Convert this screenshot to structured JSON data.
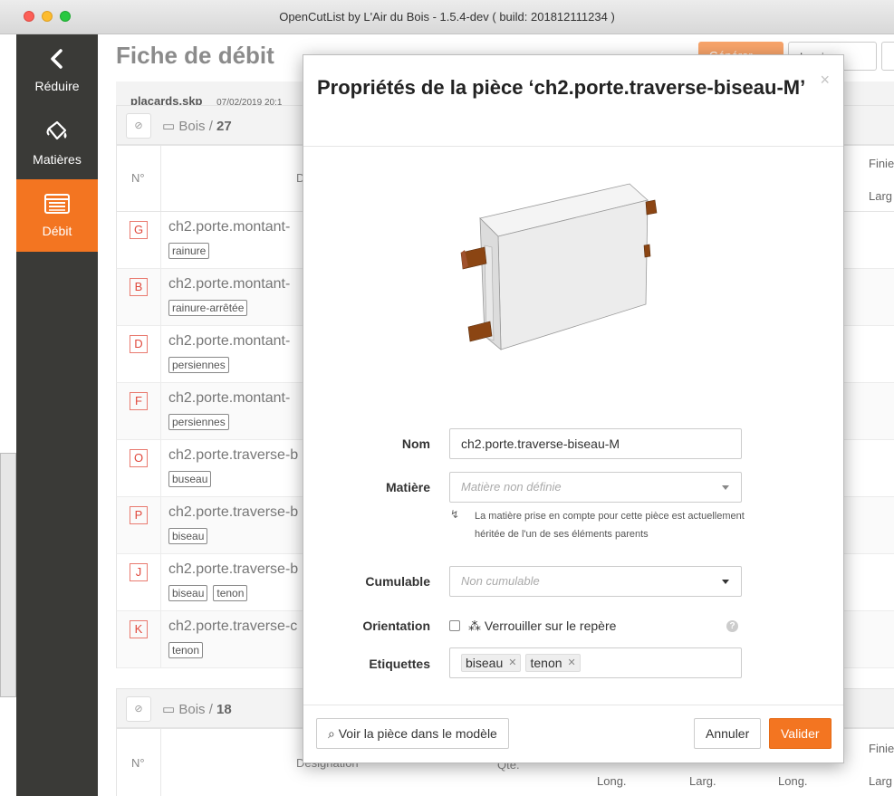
{
  "window": {
    "title": "OpenCutList by L'Air du Bois - 1.5.4-dev ( build: 201812111234 )"
  },
  "sidebar": {
    "items": [
      {
        "label": "Réduire",
        "icon": "chevron-left-icon"
      },
      {
        "label": "Matières",
        "icon": "paint-bucket-icon"
      },
      {
        "label": "Débit",
        "icon": "list-icon"
      }
    ]
  },
  "page": {
    "title": "Fiche de débit",
    "actions": {
      "refresh_label": "Générer",
      "print_label": "Imprimer"
    },
    "file": {
      "name": "placards.skp",
      "date": "07/02/2019 20:1"
    }
  },
  "groups": [
    {
      "label": "Bois / ",
      "count": "27"
    },
    {
      "label": "Bois / ",
      "count": "18"
    }
  ],
  "table": {
    "no_header": "N°",
    "designation_header": "D",
    "designation_header_full": "Désignation",
    "qty_header": "Qté.",
    "finie_header": "Finie",
    "larg_header": "Larg",
    "long_header": "Long.",
    "larg2_header": "Larg.",
    "rows": [
      {
        "letter": "G",
        "name": "ch2.porte.montant-",
        "tags": [
          "rainure"
        ]
      },
      {
        "letter": "B",
        "name": "ch2.porte.montant-",
        "tags": [
          "rainure-arrêtée"
        ]
      },
      {
        "letter": "D",
        "name": "ch2.porte.montant-",
        "tags": [
          "persiennes"
        ]
      },
      {
        "letter": "F",
        "name": "ch2.porte.montant-",
        "tags": [
          "persiennes"
        ]
      },
      {
        "letter": "O",
        "name": "ch2.porte.traverse-b",
        "tags": [
          "buseau"
        ]
      },
      {
        "letter": "P",
        "name": "ch2.porte.traverse-b",
        "tags": [
          "biseau"
        ]
      },
      {
        "letter": "J",
        "name": "ch2.porte.traverse-b",
        "tags": [
          "biseau",
          "tenon"
        ]
      },
      {
        "letter": "K",
        "name": "ch2.porte.traverse-c",
        "tags": [
          "tenon"
        ]
      }
    ]
  },
  "modal": {
    "title": "Propriétés de la pièce ‘ch2.porte.traverse-biseau-M’",
    "close": "×",
    "fields": {
      "name_label": "Nom",
      "name_value": "ch2.porte.traverse-biseau-M",
      "material_label": "Matière",
      "material_placeholder": "Matière non définie",
      "material_help": "La matière prise en compte pour cette pièce est actuellement héritée de l'un de ses éléments parents",
      "cumulable_label": "Cumulable",
      "cumulable_placeholder": "Non cumulable",
      "orientation_label": "Orientation",
      "orientation_checkbox_label": "Verrouiller sur le repère",
      "orientation_help": "?",
      "labels_label": "Etiquettes",
      "labels": [
        "biseau",
        "tenon"
      ]
    },
    "footer": {
      "show_in_model_label": "Voir la pièce dans le modèle",
      "cancel_label": "Annuler",
      "validate_label": "Valider"
    }
  },
  "colors": {
    "accent": "#f37521",
    "sidebar": "#3a3a37",
    "letter": "#e0483c"
  }
}
